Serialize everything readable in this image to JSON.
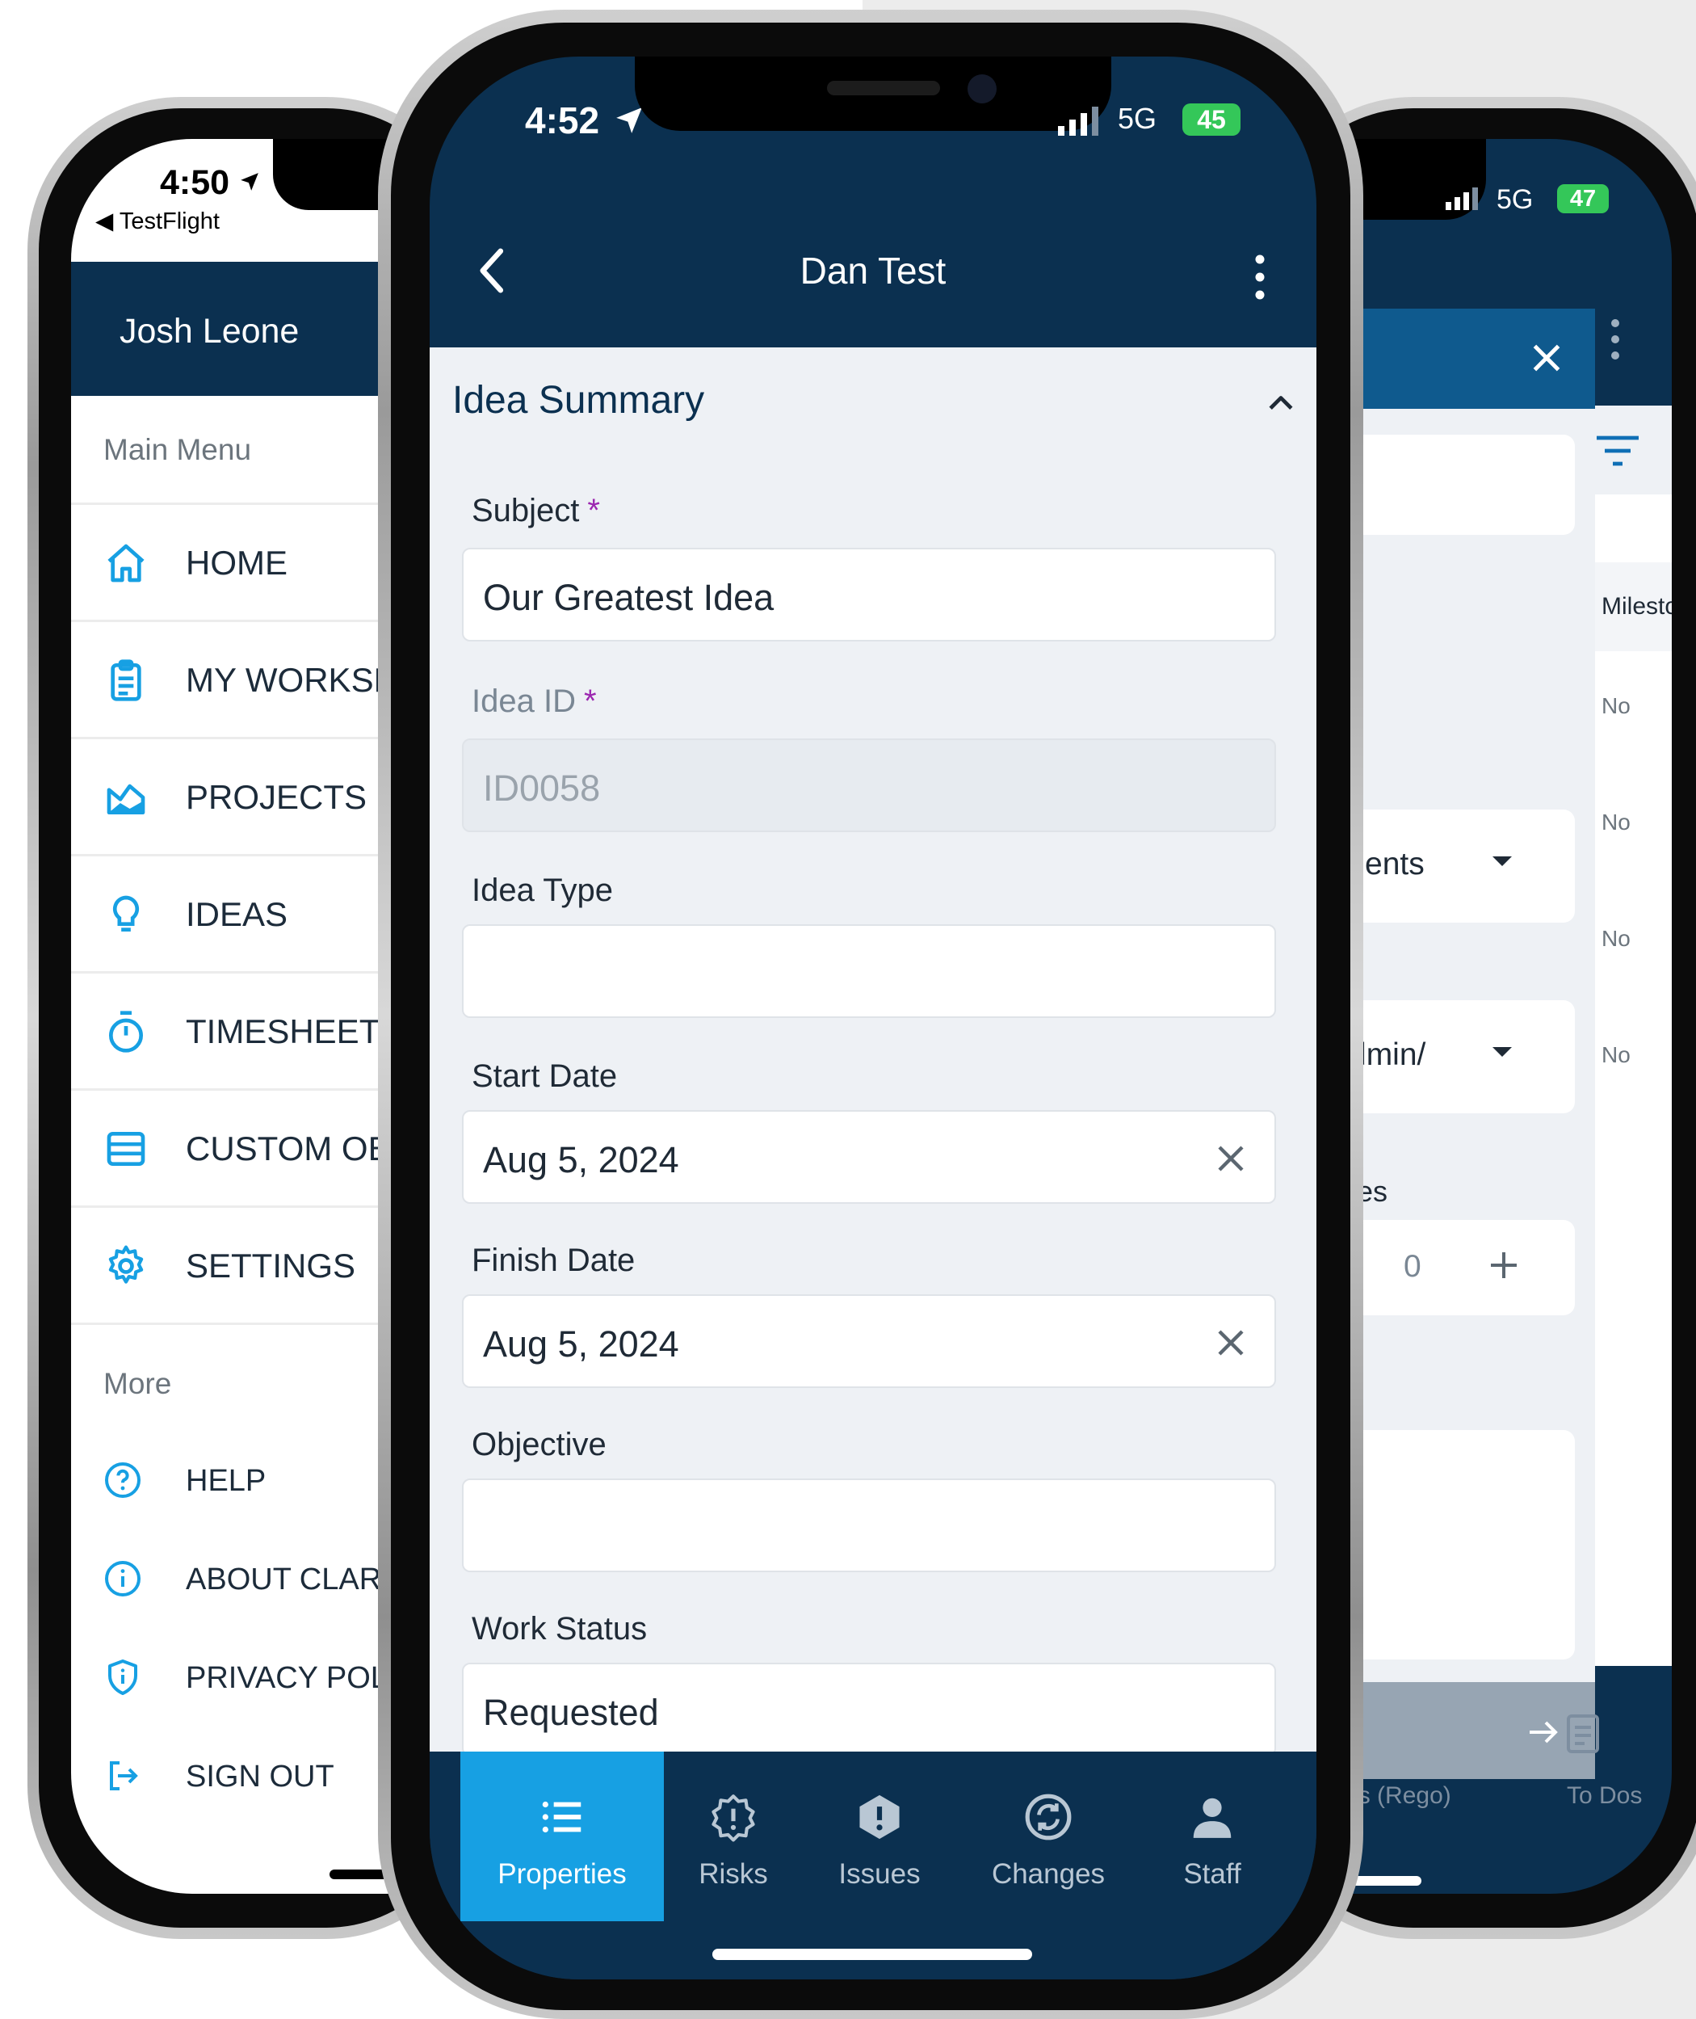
{
  "left_phone": {
    "status": {
      "time": "4:50",
      "back_app": "TestFlight"
    },
    "user_name": "Josh Leone",
    "main_menu_title": "Main Menu",
    "main_items": [
      {
        "label": "HOME",
        "icon": "home-icon"
      },
      {
        "label": "MY WORKSF",
        "icon": "clipboard-icon"
      },
      {
        "label": "PROJECTS",
        "icon": "chart-area-icon"
      },
      {
        "label": "IDEAS",
        "icon": "lightbulb-icon"
      },
      {
        "label": "TIMESHEETS",
        "icon": "stopwatch-icon"
      },
      {
        "label": "CUSTOM OB",
        "icon": "table-icon"
      },
      {
        "label": "SETTINGS",
        "icon": "gear-icon"
      }
    ],
    "more_title": "More",
    "more_items": [
      {
        "label": "HELP",
        "icon": "help-circle-icon"
      },
      {
        "label": "ABOUT CLARI",
        "icon": "info-circle-icon"
      },
      {
        "label": "PRIVACY POLI",
        "icon": "shield-icon"
      },
      {
        "label": "SIGN OUT",
        "icon": "sign-out-icon"
      }
    ]
  },
  "center_phone": {
    "status": {
      "time": "4:52",
      "network": "5G",
      "battery": "45"
    },
    "title": "Dan Test",
    "section_title": "Idea Summary",
    "fields": {
      "subject": {
        "label": "Subject",
        "required": "*",
        "value": "Our Greatest Idea"
      },
      "idea_id": {
        "label": "Idea ID",
        "required": "*",
        "value": "ID0058"
      },
      "idea_type": {
        "label": "Idea Type",
        "value": ""
      },
      "start_date": {
        "label": "Start Date",
        "value": "Aug 5, 2024"
      },
      "finish_date": {
        "label": "Finish Date",
        "value": "Aug 5, 2024"
      },
      "objective": {
        "label": "Objective",
        "value": ""
      },
      "work_status": {
        "label": "Work Status",
        "value": "Requested"
      }
    },
    "tabs": [
      {
        "label": "Properties",
        "icon": "list-icon",
        "active": true
      },
      {
        "label": "Risks",
        "icon": "warning-badge-icon"
      },
      {
        "label": "Issues",
        "icon": "alert-badge-icon"
      },
      {
        "label": "Changes",
        "icon": "changes-icon"
      },
      {
        "label": "Staff",
        "icon": "person-icon"
      }
    ]
  },
  "right_phone": {
    "status": {
      "network": "5G",
      "battery": "47"
    },
    "column_header": "Milesto",
    "rows": [
      "No",
      "No",
      "No",
      "No"
    ],
    "dropdown1": "ents",
    "dropdown2": "dmin/",
    "stepper_label": "es",
    "stepper_value": "0",
    "bottom_tab_left": "atus (Rego)",
    "bottom_tab_right": "To Dos"
  },
  "colors": {
    "navy": "#0b3050",
    "accent_blue": "#17a0e3",
    "required": "#9c27b0",
    "battery_green": "#34c759"
  }
}
